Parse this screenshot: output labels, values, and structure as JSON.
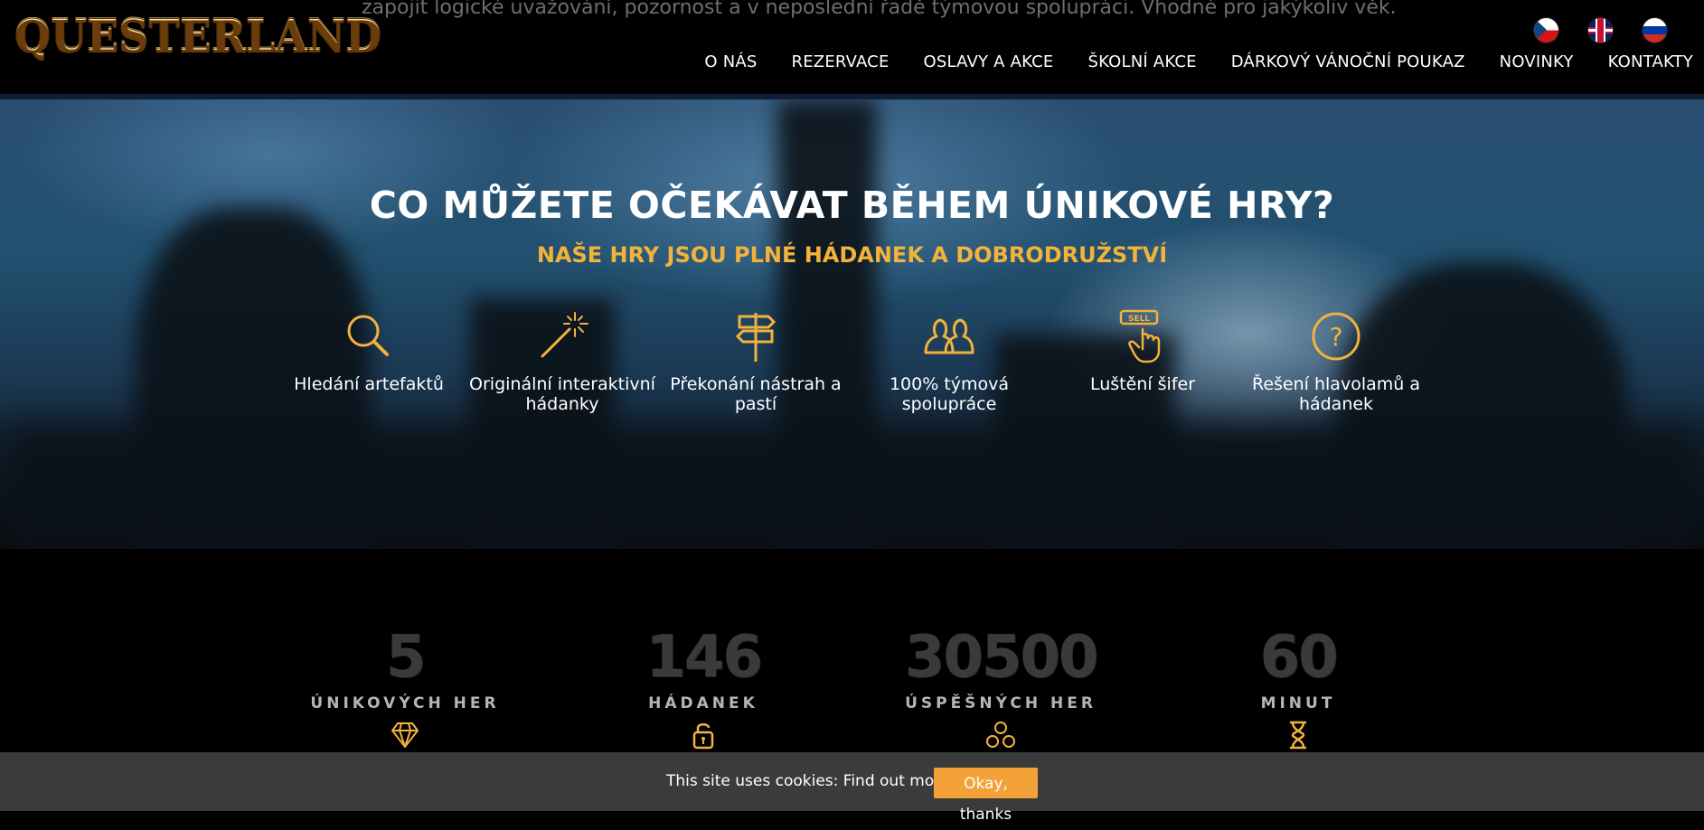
{
  "header": {
    "ghost_text": "zapojit logické uvažování, pozornost a v neposlední řadě týmovou spolupráci. Vhodné pro jakýkoliv věk.",
    "logo": "QUESTERLAND",
    "nav": [
      "O NÁS",
      "REZERVACE",
      "OSLAVY A AKCE",
      "ŠKOLNÍ AKCE",
      "DÁRKOVÝ VÁNOČNÍ POUKAZ",
      "NOVINKY",
      "KONTAKTY"
    ]
  },
  "hero": {
    "title": "CO MŮŽETE OČEKÁVAT BĚHEM ÚNIKOVÉ HRY?",
    "subtitle": "NAŠE HRY JSOU PLNÉ HÁDANEK A DOBRODRUŽSTVÍ",
    "features": [
      {
        "label": "Hledání artefaktů",
        "icon": "magnifier-icon"
      },
      {
        "label": "Originální interaktivní hádanky",
        "icon": "magic-wand-icon"
      },
      {
        "label": "Překonání nástrah a pastí",
        "icon": "signpost-icon"
      },
      {
        "label": "100% týmová spolupráce",
        "icon": "team-icon"
      },
      {
        "label": "Luštění šifer",
        "icon": "sell-hand-icon"
      },
      {
        "label": "Řešení hlavolamů a hádanek",
        "icon": "question-icon"
      }
    ]
  },
  "stats": [
    {
      "number": "5",
      "label": "ÚNIKOVÝCH HER",
      "icon": "diamond-icon"
    },
    {
      "number": "146",
      "label": "HÁDANEK",
      "icon": "padlock-icon"
    },
    {
      "number": "30500",
      "label": "ÚSPĚŠNÝCH HER",
      "icon": "people-group-icon"
    },
    {
      "number": "60",
      "label": "MINUT",
      "icon": "hourglass-icon"
    }
  ],
  "cookie": {
    "text": "This site uses cookies:",
    "link": "Find out more.",
    "button": "Okay, thanks"
  },
  "colors": {
    "accent": "#f3b23b",
    "button": "#f3a23a",
    "cookie_bar": "#3b3b3b",
    "stat_number": "#3a3a3a"
  }
}
